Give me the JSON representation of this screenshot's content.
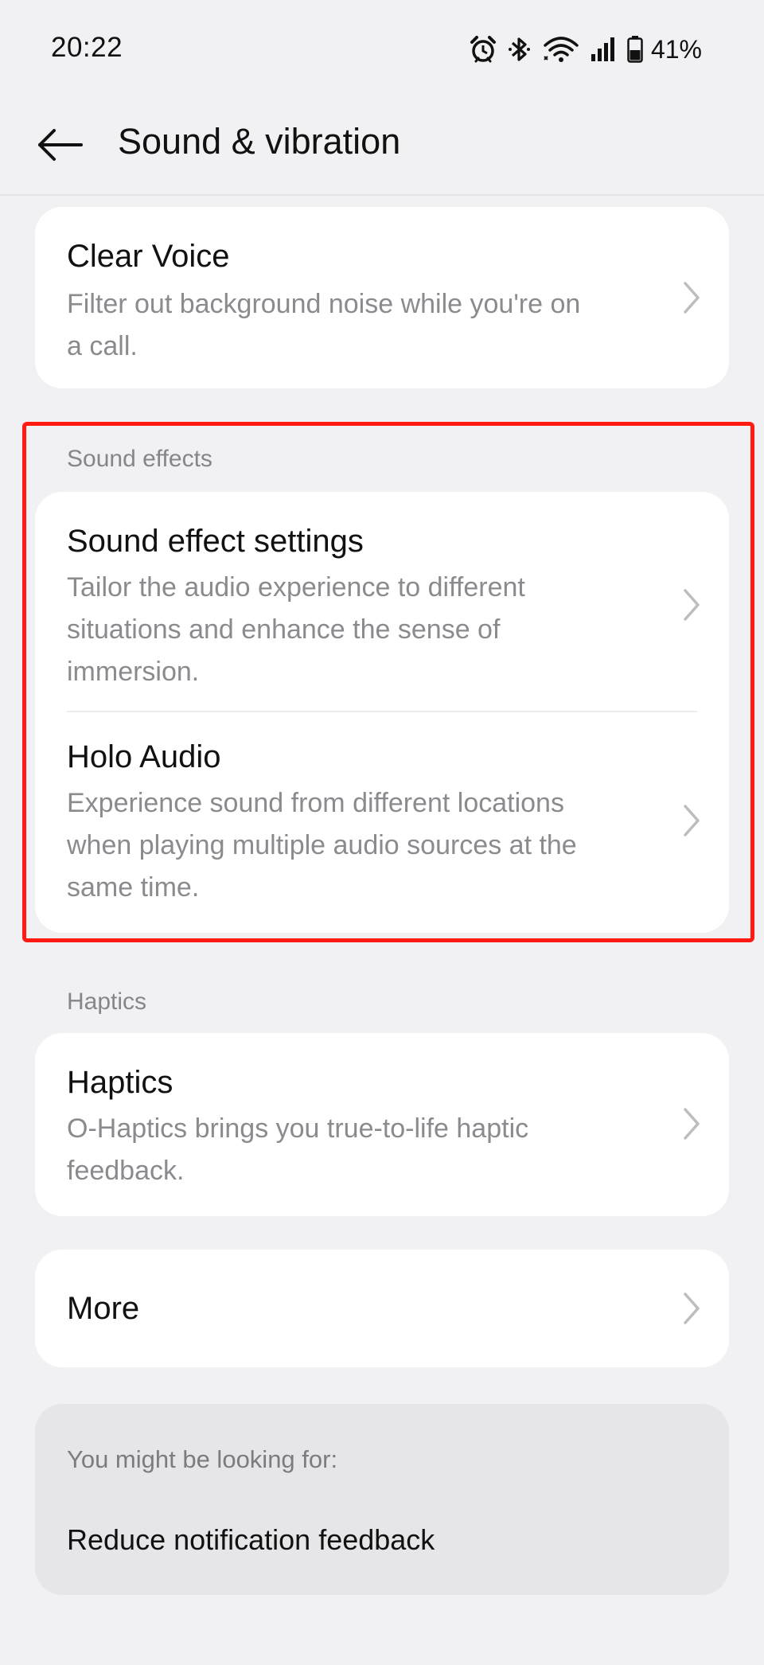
{
  "status_bar": {
    "time": "20:22",
    "battery": "41%",
    "icons": [
      "alarm-icon",
      "bluetooth-icon",
      "wifi-icon",
      "signal-icon",
      "battery-icon"
    ]
  },
  "app_bar": {
    "title": "Sound & vibration",
    "back_icon": "back-arrow-icon"
  },
  "clear_voice": {
    "title": "Clear Voice",
    "subtitle_line1": "Filter out background noise while you're on",
    "subtitle_line2": "a call."
  },
  "sound_effects_section": {
    "label": "Sound effects",
    "items": [
      {
        "title": "Sound effect settings",
        "lines": [
          "Tailor the audio experience to different",
          "situations and enhance the sense of",
          "immersion."
        ]
      },
      {
        "title": "Holo Audio",
        "lines": [
          "Experience sound from different locations",
          "when playing multiple audio sources at the",
          "same time."
        ]
      }
    ]
  },
  "haptics_section": {
    "label": "Haptics",
    "item": {
      "title": "Haptics",
      "lines": [
        "O-Haptics brings you true-to-life haptic",
        "feedback."
      ]
    }
  },
  "more": {
    "title": "More"
  },
  "suggestions": {
    "label": "You might be looking for:",
    "link": "Reduce notification feedback"
  },
  "colors": {
    "background": "#f1f1f3",
    "card": "#ffffff",
    "highlight_border": "#ff1a12",
    "secondary_text": "#8b8b8f"
  }
}
